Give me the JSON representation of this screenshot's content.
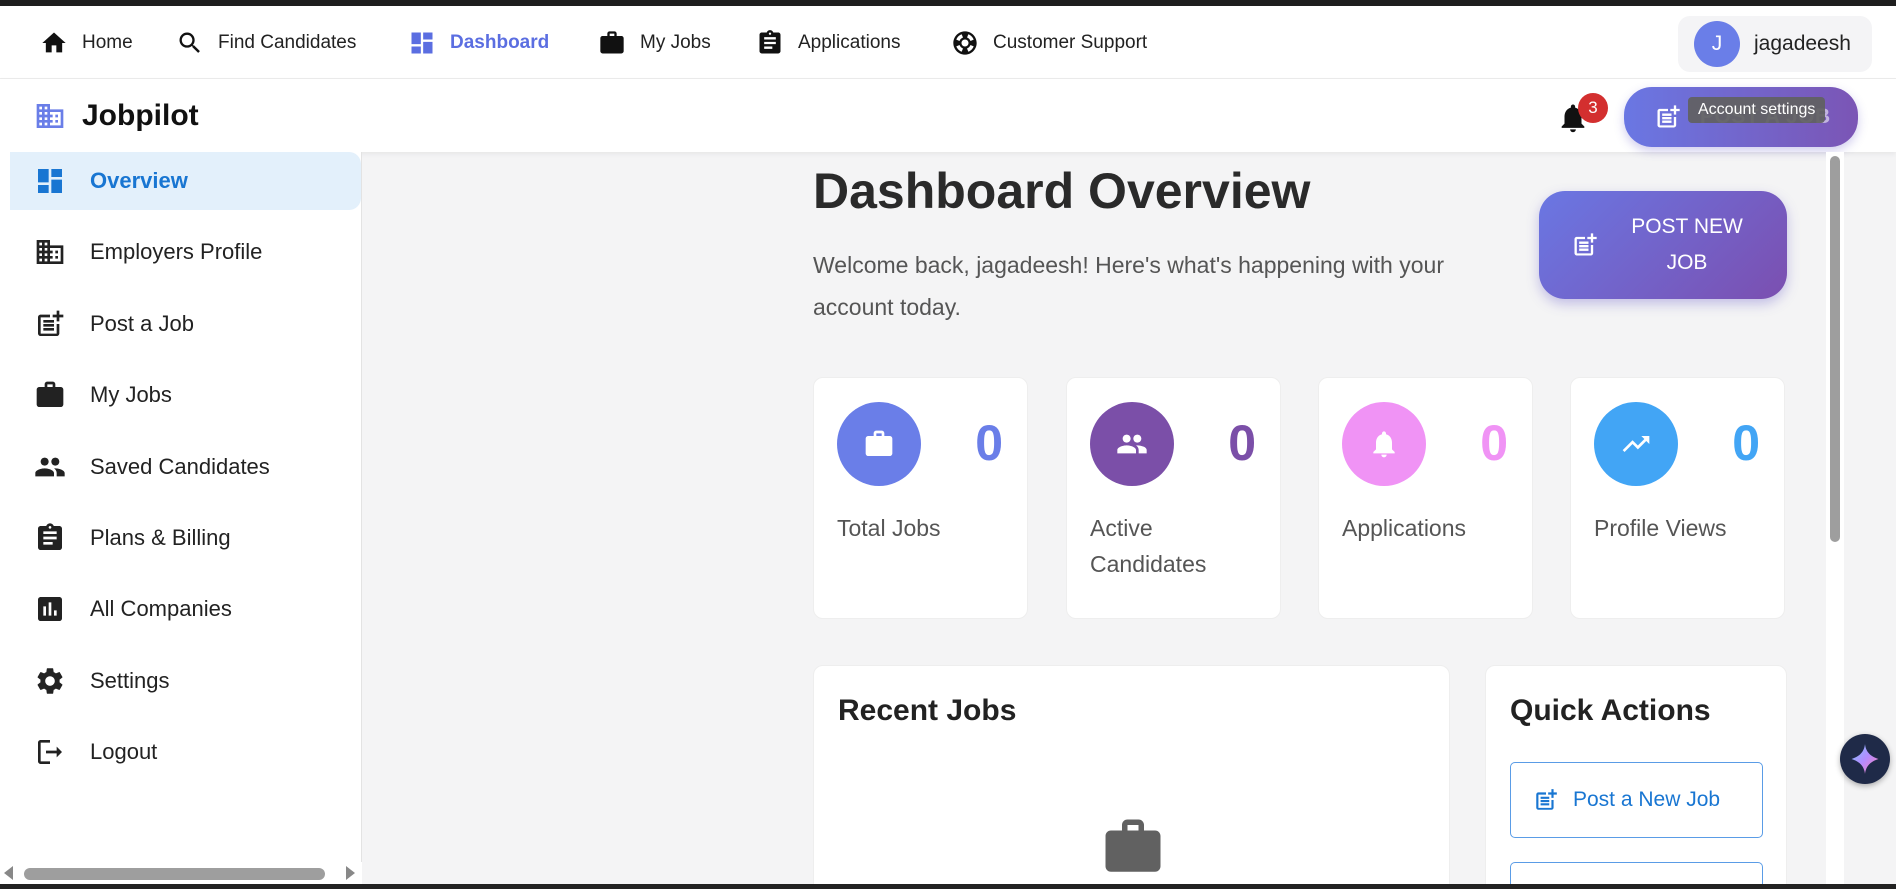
{
  "topnav": {
    "items": [
      {
        "label": "Home",
        "icon": "home-icon"
      },
      {
        "label": "Find Candidates",
        "icon": "search-icon"
      },
      {
        "label": "Dashboard",
        "icon": "dashboard-icon",
        "active": true
      },
      {
        "label": "My Jobs",
        "icon": "briefcase-icon"
      },
      {
        "label": "Applications",
        "icon": "clipboard-icon"
      },
      {
        "label": "Customer Support",
        "icon": "lifebuoy-icon"
      }
    ],
    "user": {
      "initial": "J",
      "name": "jagadeesh"
    }
  },
  "header": {
    "brand": "Jobpilot",
    "notifications_count": "3",
    "post_job_label": "POST A JOB",
    "tooltip": "Account settings"
  },
  "sidebar": {
    "items": [
      {
        "label": "Overview",
        "icon": "dashboard-icon",
        "active": true
      },
      {
        "label": "Employers Profile",
        "icon": "building-icon"
      },
      {
        "label": "Post a Job",
        "icon": "post-add-icon"
      },
      {
        "label": "My Jobs",
        "icon": "briefcase-icon"
      },
      {
        "label": "Saved Candidates",
        "icon": "people-icon"
      },
      {
        "label": "Plans & Billing",
        "icon": "clipboard-icon"
      },
      {
        "label": "All Companies",
        "icon": "chart-icon"
      },
      {
        "label": "Settings",
        "icon": "gear-icon"
      },
      {
        "label": "Logout",
        "icon": "logout-icon"
      }
    ]
  },
  "main": {
    "title": "Dashboard Overview",
    "welcome": "Welcome back, jagadeesh! Here's what's happening with your account today.",
    "post_new_job_label": "POST NEW JOB",
    "stats": [
      {
        "label": "Total Jobs",
        "value": "0",
        "color": "#6a7ee8",
        "icon": "briefcase-icon"
      },
      {
        "label": "Active Candidates",
        "value": "0",
        "color": "#7b4fa8",
        "icon": "people-icon"
      },
      {
        "label": "Applications",
        "value": "0",
        "color": "#f093f5",
        "icon": "bell-icon"
      },
      {
        "label": "Profile Views",
        "value": "0",
        "color": "#42a5f5",
        "icon": "trending-up-icon"
      }
    ],
    "recent_jobs_title": "Recent Jobs",
    "quick_actions_title": "Quick Actions",
    "quick_actions": [
      {
        "label": "Post a New Job",
        "icon": "post-add-icon"
      }
    ]
  }
}
